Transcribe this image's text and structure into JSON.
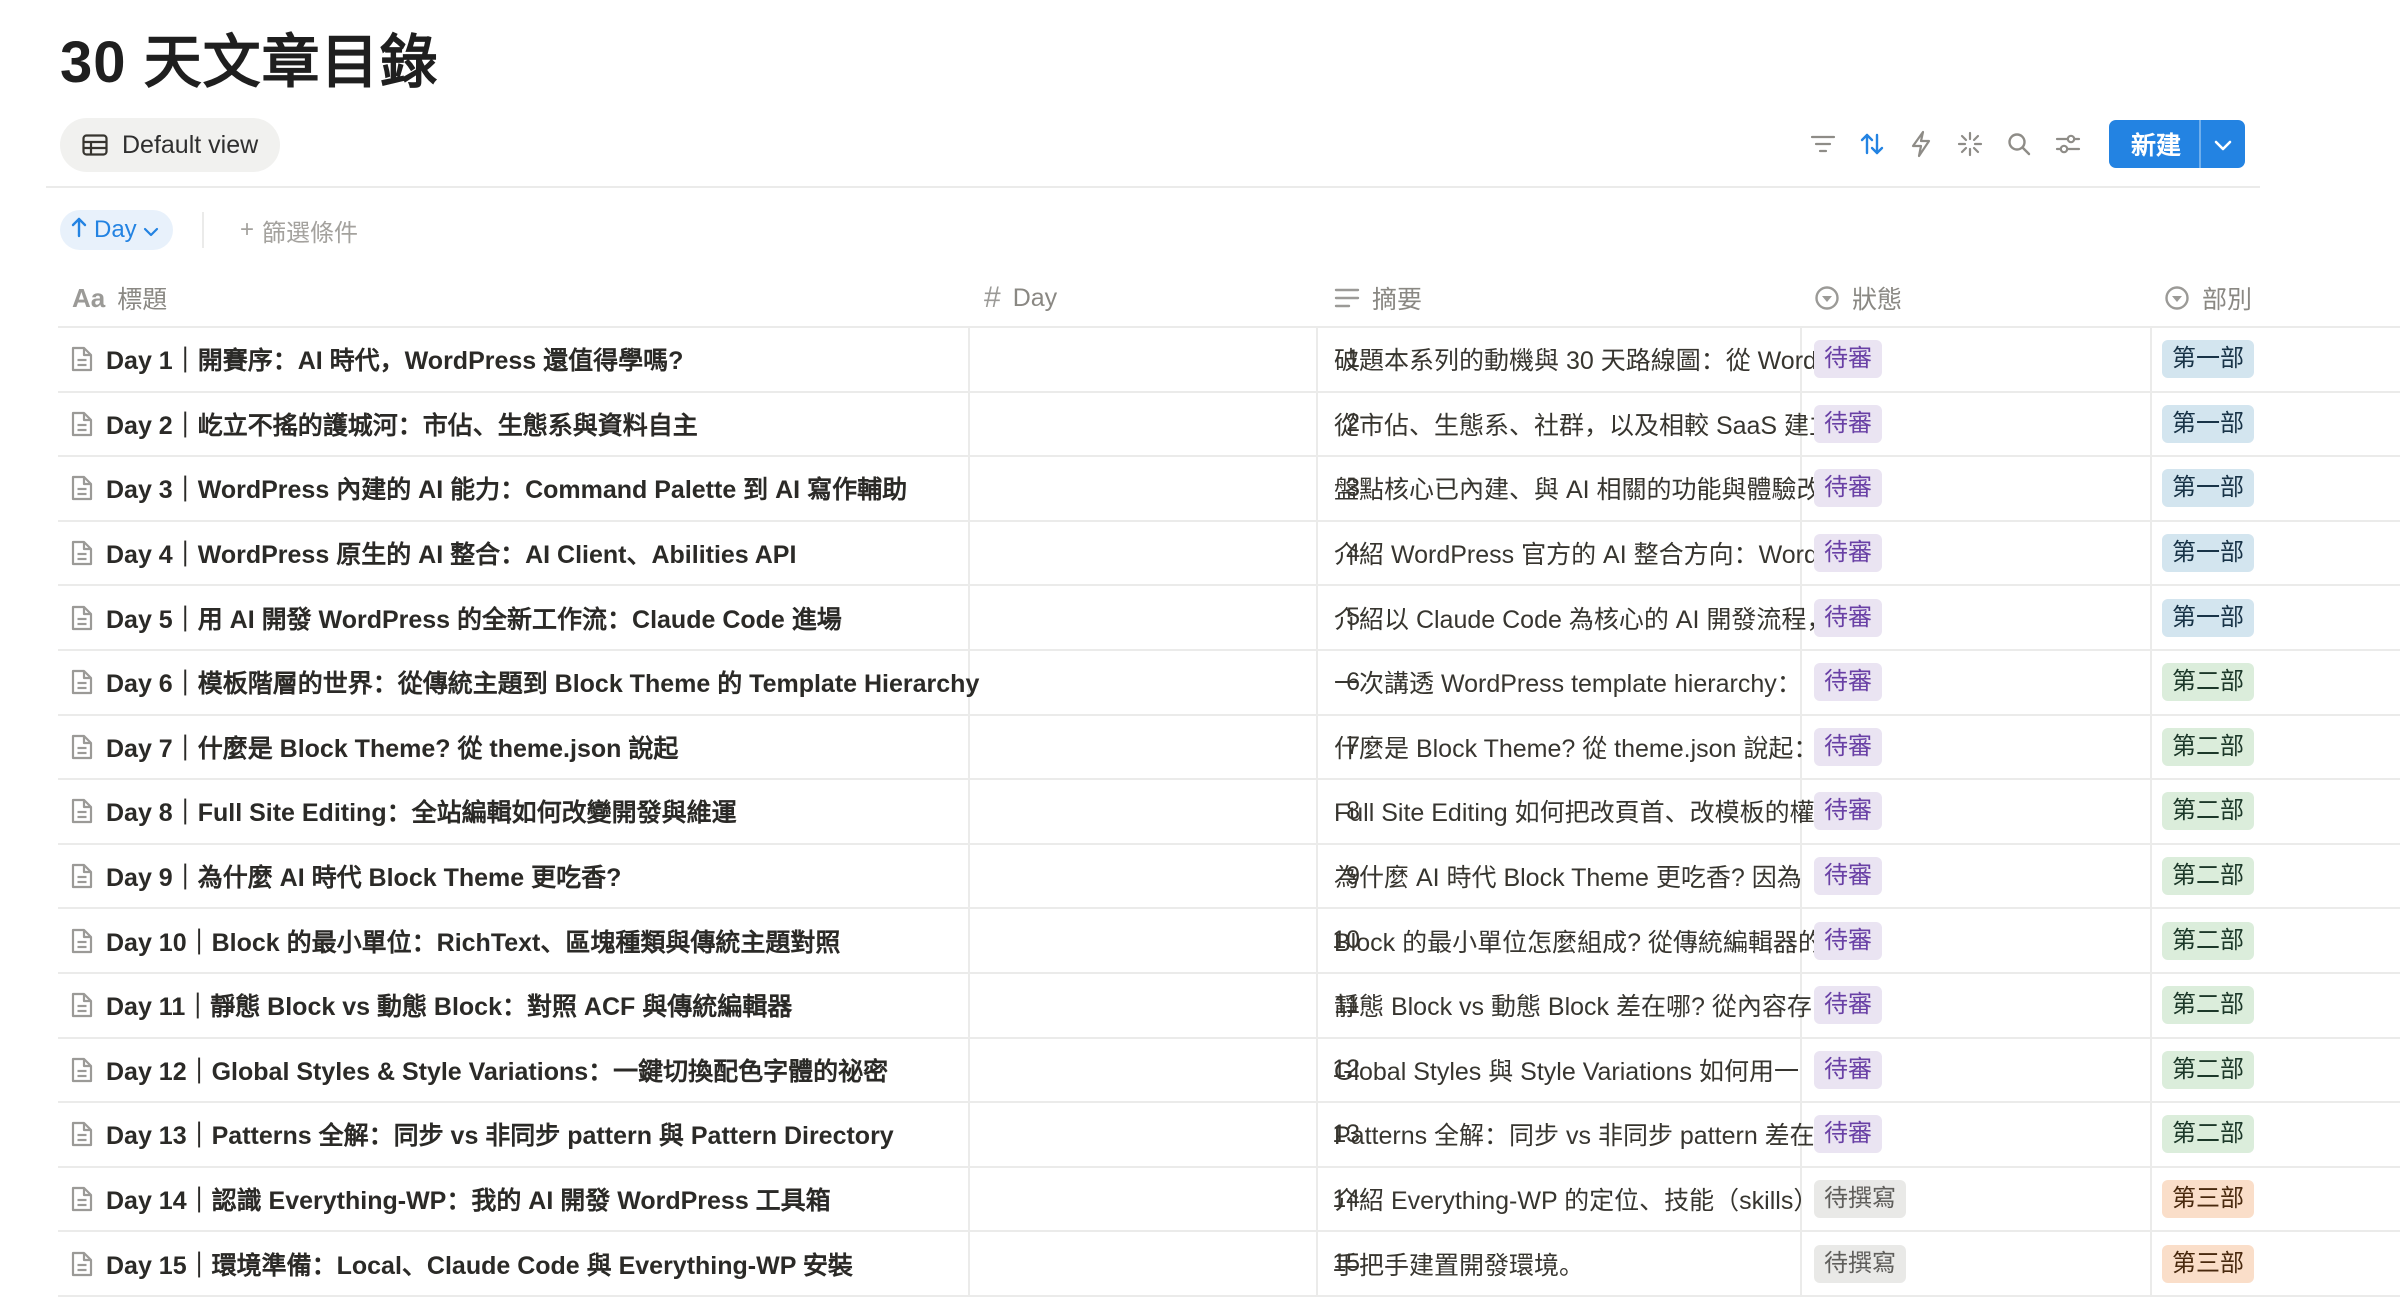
{
  "page": {
    "title": "30 天文章目錄"
  },
  "views": {
    "active_tab": {
      "label": "Default view",
      "icon": "table-icon"
    }
  },
  "toolbar": {
    "icons": [
      "filter-icon",
      "sort-icon",
      "lightning-icon",
      "sparkle-icon",
      "search-icon",
      "settings-icon"
    ],
    "new_label": "新建",
    "new_dropdown_icon": "chevron-down-icon"
  },
  "filters": {
    "sort_chip": {
      "label": "Day",
      "direction_icon": "arrow-up-icon"
    },
    "add_filter_label": "篩選條件",
    "add_filter_prefix": "+"
  },
  "table": {
    "columns": [
      {
        "label": "標題",
        "icon": "text-aa-icon"
      },
      {
        "label": "Day",
        "icon": "hash-icon"
      },
      {
        "label": "摘要",
        "icon": "lines-icon"
      },
      {
        "label": "狀態",
        "icon": "status-icon"
      },
      {
        "label": "部別",
        "icon": "select-icon"
      }
    ],
    "rows": [
      {
        "title": "Day 1｜開賽序：AI 時代，WordPress 還值得學嗎?",
        "day": "1",
        "summary": "破題本系列的動機與 30 天路線圖：從 Word",
        "status": "待審",
        "part": "第一部"
      },
      {
        "title": "Day 2｜屹立不搖的護城河：市佔、生態系與資料自主",
        "day": "2",
        "summary": "從市佔、生態系、社群，以及相較 SaaS 建立",
        "status": "待審",
        "part": "第一部"
      },
      {
        "title": "Day 3｜WordPress 內建的 AI 能力：Command Palette 到 AI 寫作輔助",
        "day": "3",
        "summary": "盤點核心已內建、與 AI 相關的功能與體驗改",
        "status": "待審",
        "part": "第一部"
      },
      {
        "title": "Day 4｜WordPress 原生的 AI 整合：AI Client、Abilities API",
        "day": "4",
        "summary": "介紹 WordPress 官方的 AI 整合方向：Word",
        "status": "待審",
        "part": "第一部"
      },
      {
        "title": "Day 5｜用 AI 開發 WordPress 的全新工作流：Claude Code 進場",
        "day": "5",
        "summary": "介紹以 Claude Code 為核心的 AI 開發流程，",
        "status": "待審",
        "part": "第一部"
      },
      {
        "title": "Day 6｜模板階層的世界：從傳統主題到 Block Theme 的 Template Hierarchy",
        "day": "6",
        "summary": "一次講透 WordPress template hierarchy：",
        "status": "待審",
        "part": "第二部"
      },
      {
        "title": "Day 7｜什麼是 Block Theme? 從 theme.json 說起",
        "day": "7",
        "summary": "什麼是 Block Theme? 從 theme.json 說起：",
        "status": "待審",
        "part": "第二部"
      },
      {
        "title": "Day 8｜Full Site Editing：全站編輯如何改變開發與維運",
        "day": "8",
        "summary": "Full Site Editing 如何把改頁首、改模板的權",
        "status": "待審",
        "part": "第二部"
      },
      {
        "title": "Day 9｜為什麼 AI 時代 Block Theme 更吃香?",
        "day": "9",
        "summary": "為什麼 AI 時代 Block Theme 更吃香? 因為",
        "status": "待審",
        "part": "第二部"
      },
      {
        "title": "Day 10｜Block 的最小單位：RichText、區塊種類與傳統主題對照",
        "day": "10",
        "summary": "Block 的最小單位怎麼組成? 從傳統編輯器的",
        "status": "待審",
        "part": "第二部"
      },
      {
        "title": "Day 11｜靜態 Block vs 動態 Block：對照 ACF 與傳統編輯器",
        "day": "11",
        "summary": "靜態 Block vs 動態 Block 差在哪? 從內容存",
        "status": "待審",
        "part": "第二部"
      },
      {
        "title": "Day 12｜Global Styles & Style Variations：一鍵切換配色字體的祕密",
        "day": "12",
        "summary": "Global Styles 與 Style Variations 如何用一",
        "status": "待審",
        "part": "第二部"
      },
      {
        "title": "Day 13｜Patterns 全解：同步 vs 非同步 pattern 與 Pattern Directory",
        "day": "13",
        "summary": "Patterns 全解：同步 vs 非同步 pattern 差在",
        "status": "待審",
        "part": "第二部"
      },
      {
        "title": "Day 14｜認識 Everything-WP：我的 AI 開發 WordPress 工具箱",
        "day": "14",
        "summary": "介紹 Everything-WP 的定位、技能（skills）",
        "status": "待撰寫",
        "part": "第三部"
      },
      {
        "title": "Day 15｜環境準備：Local、Claude Code 與 Everything-WP 安裝",
        "day": "15",
        "summary": "手把手建置開發環境。",
        "status": "待撰寫",
        "part": "第三部"
      }
    ]
  },
  "colors": {
    "accent": "#2383e2",
    "status_review_bg": "#eae4f2",
    "status_draft_bg": "#e9e9e7",
    "part_one_bg": "#d3e5ef",
    "part_two_bg": "#dbeddb",
    "part_three_bg": "#fadec9"
  }
}
